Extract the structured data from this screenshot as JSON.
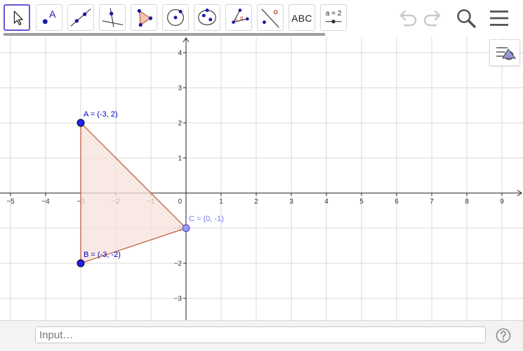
{
  "toolbar": {
    "text_tool_label": "ABC",
    "slider_tool_label": "a = 2",
    "tools": [
      {
        "name": "move-tool-icon"
      },
      {
        "name": "point-tool-icon",
        "label": "A"
      },
      {
        "name": "line-tool-icon"
      },
      {
        "name": "perpendicular-line-tool-icon"
      },
      {
        "name": "polygon-tool-icon"
      },
      {
        "name": "circle-tool-icon"
      },
      {
        "name": "ellipse-tool-icon"
      },
      {
        "name": "angle-tool-icon",
        "label": "α"
      },
      {
        "name": "reflect-tool-icon"
      },
      {
        "name": "text-tool-icon"
      },
      {
        "name": "slider-tool-icon"
      }
    ]
  },
  "top_icons": [
    "undo-icon",
    "redo-icon",
    "search-icon",
    "menu-icon"
  ],
  "colors": {
    "active_border": "#6557d2",
    "point_fill": "#2020ff",
    "point_dependent_fill": "#9999ff",
    "polygon_stroke": "#c0603a",
    "polygon_fill": "#f7e2dc",
    "label_blue": "#0000cc",
    "label_light": "#7777ee",
    "grid": "#d8d8d8",
    "axis": "#222222"
  },
  "graph": {
    "x_range": [
      -5.3,
      9.6
    ],
    "y_range": [
      -3.6,
      4.44
    ],
    "x_ticks": [
      -5,
      -4,
      -3,
      -2,
      -1,
      1,
      2,
      3,
      4,
      5,
      6,
      7,
      8,
      9
    ],
    "x_tick_labels": [
      "−5",
      "−4",
      "−3",
      "−2",
      "−1",
      "1",
      "2",
      "3",
      "4",
      "5",
      "6",
      "7",
      "8",
      "9"
    ],
    "y_ticks": [
      -3,
      -2,
      -1,
      1,
      2,
      3,
      4
    ],
    "y_tick_labels": [
      "−3",
      "−2",
      "−1",
      "1",
      "2",
      "3",
      "4"
    ],
    "origin_label": "0",
    "points": [
      {
        "id": "A",
        "x": -3,
        "y": 2,
        "label": "A = (-3, 2)",
        "dependent": false
      },
      {
        "id": "B",
        "x": -3,
        "y": -2,
        "label": "B = (-3, -2)",
        "dependent": false
      },
      {
        "id": "C",
        "x": 0,
        "y": -1,
        "label": "C = (0, -1)",
        "dependent": true
      }
    ]
  },
  "style_bar": {
    "icon": "style-bar-toggle-icon"
  },
  "input_bar": {
    "placeholder": "Input…",
    "help_icon": "help-icon"
  }
}
